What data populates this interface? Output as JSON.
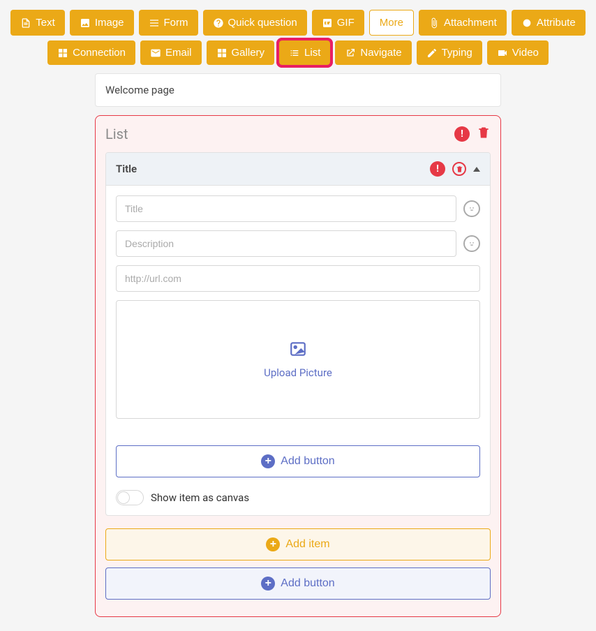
{
  "toolbar": {
    "row1": [
      {
        "icon": "file",
        "label": "Text"
      },
      {
        "icon": "image",
        "label": "Image"
      },
      {
        "icon": "form",
        "label": "Form"
      },
      {
        "icon": "question",
        "label": "Quick question"
      },
      {
        "icon": "gif",
        "label": "GIF"
      }
    ],
    "more": "More",
    "row2": [
      {
        "icon": "attachment",
        "label": "Attachment"
      },
      {
        "icon": "attribute",
        "label": "Attribute"
      },
      {
        "icon": "connection",
        "label": "Connection"
      },
      {
        "icon": "email",
        "label": "Email"
      },
      {
        "icon": "gallery",
        "label": "Gallery"
      },
      {
        "icon": "list",
        "label": "List",
        "highlighted": true
      },
      {
        "icon": "navigate",
        "label": "Navigate"
      },
      {
        "icon": "typing",
        "label": "Typing"
      },
      {
        "icon": "video",
        "label": "Video"
      }
    ]
  },
  "welcome_card": "Welcome page",
  "list_panel": {
    "title": "List",
    "accordion": {
      "title": "Title",
      "title_placeholder": "Title",
      "description_placeholder": "Description",
      "url_placeholder": "http://url.com",
      "upload_label": "Upload Picture",
      "add_button_label": "Add button",
      "toggle_label": "Show item as canvas"
    },
    "add_item_label": "Add item",
    "add_button_label": "Add button"
  }
}
